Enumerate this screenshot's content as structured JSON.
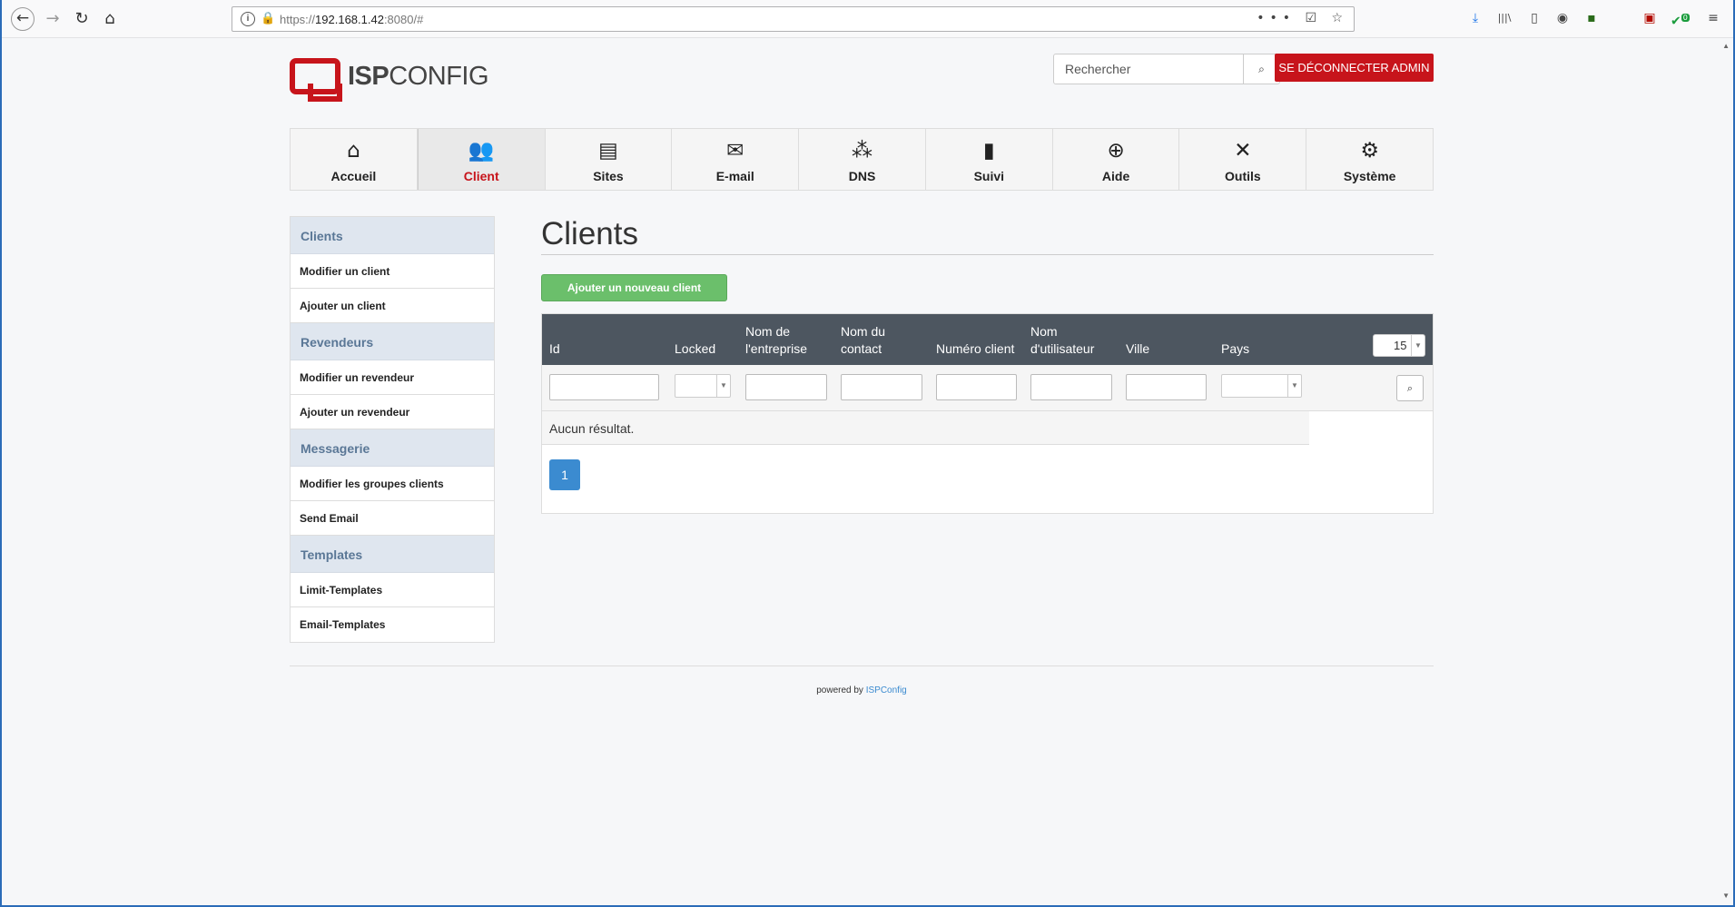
{
  "browser": {
    "url_prefix": "https://",
    "url_host": "192.168.1.42",
    "url_rest": ":8080/#",
    "url_actions": "••• ☑ ☆",
    "icons": {
      "back": "←",
      "forward": "→",
      "reload": "↻",
      "home": "⌂",
      "download": "⤓",
      "library": "|||\\",
      "sidebar": "▯",
      "account": "◉",
      "extension": "▪",
      "pdf": "▣",
      "shield": "✔",
      "badge": "0",
      "menu": "≡"
    }
  },
  "header": {
    "logo_bold": "ISP",
    "logo_light": "CONFIG",
    "search_placeholder": "Rechercher",
    "search_icon": "⌕",
    "logout_label": "SE DÉCONNECTER ADMIN"
  },
  "mainnav": {
    "tabs": [
      {
        "label": "Accueil",
        "icon": "⌂",
        "icon_name": "home-icon"
      },
      {
        "label": "Client",
        "icon": "👥",
        "icon_name": "users-icon"
      },
      {
        "label": "Sites",
        "icon": "▤",
        "icon_name": "sites-icon"
      },
      {
        "label": "E-mail",
        "icon": "✉",
        "icon_name": "email-icon"
      },
      {
        "label": "DNS",
        "icon": "⁂",
        "icon_name": "dns-icon"
      },
      {
        "label": "Suivi",
        "icon": "▮",
        "icon_name": "traffic-light-icon"
      },
      {
        "label": "Aide",
        "icon": "⊕",
        "icon_name": "lifebuoy-icon"
      },
      {
        "label": "Outils",
        "icon": "✕",
        "icon_name": "tools-icon"
      },
      {
        "label": "Système",
        "icon": "⚙",
        "icon_name": "gear-icon"
      }
    ],
    "active_index": 1
  },
  "sidebar": {
    "sections": [
      {
        "title": "Clients",
        "items": [
          "Modifier un client",
          "Ajouter un client"
        ]
      },
      {
        "title": "Revendeurs",
        "items": [
          "Modifier un revendeur",
          "Ajouter un revendeur"
        ]
      },
      {
        "title": "Messagerie",
        "items": [
          "Modifier les groupes clients",
          "Send Email"
        ]
      },
      {
        "title": "Templates",
        "items": [
          "Limit-Templates",
          "Email-Templates"
        ]
      }
    ]
  },
  "main": {
    "title": "Clients",
    "add_button": "Ajouter un nouveau client",
    "table": {
      "columns": [
        "Id",
        "Locked",
        "Nom de\nl'entreprise",
        "Nom du\ncontact",
        "Numéro client",
        "Nom\nd'utilisateur",
        "Ville",
        "Pays"
      ],
      "per_page": "15",
      "empty_message": "Aucun résultat.",
      "current_page": "1"
    }
  },
  "footer": {
    "prefix": "powered by",
    "link": "ISPConfig"
  },
  "colors": {
    "brand_red": "#c7141b",
    "table_header": "#4d5660",
    "add_green": "#6bbf6b",
    "pager_blue": "#3b8bd0",
    "sidebar_head": "#dfe6ef"
  }
}
